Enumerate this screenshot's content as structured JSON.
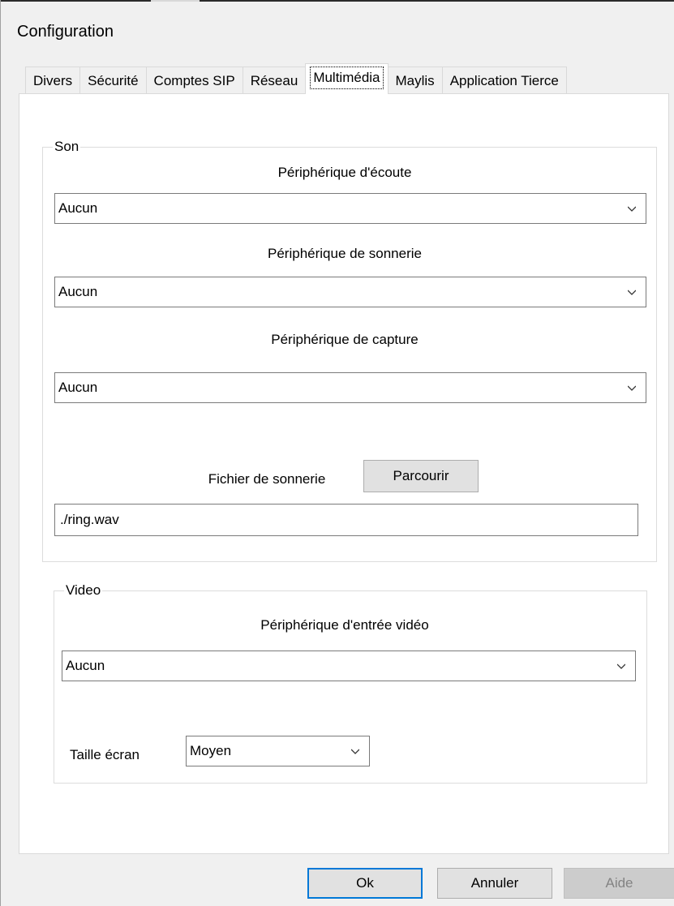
{
  "window": {
    "title": "Configuration"
  },
  "tabs": [
    {
      "label": "Divers"
    },
    {
      "label": "Sécurité"
    },
    {
      "label": "Comptes SIP"
    },
    {
      "label": "Réseau"
    },
    {
      "label": "Multimédia",
      "active": true
    },
    {
      "label": "Maylis"
    },
    {
      "label": "Application Tierce"
    }
  ],
  "son": {
    "legend": "Son",
    "listen_label": "Périphérique d'écoute",
    "listen_value": "Aucun",
    "ring_label": "Périphérique de sonnerie",
    "ring_value": "Aucun",
    "capture_label": "Périphérique de capture",
    "capture_value": "Aucun",
    "ringfile_label": "Fichier de sonnerie",
    "browse_label": "Parcourir",
    "ringfile_value": "./ring.wav"
  },
  "video": {
    "legend": "Video",
    "input_label": "Périphérique d'entrée vidéo",
    "input_value": "Aucun",
    "size_label": "Taille écran",
    "size_value": "Moyen"
  },
  "buttons": {
    "ok": "Ok",
    "cancel": "Annuler",
    "help": "Aide"
  },
  "icons": {
    "dropdown": "chevron-down-icon"
  }
}
